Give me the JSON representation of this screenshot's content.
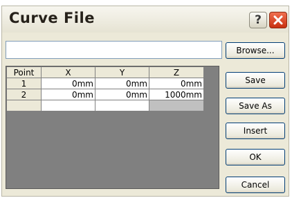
{
  "window": {
    "title": "Curve File",
    "help_glyph": "?",
    "close_glyph": "✕"
  },
  "file_path": {
    "value": ""
  },
  "buttons": {
    "browse": "Browse...",
    "save": "Save",
    "save_as": "Save As",
    "insert": "Insert",
    "ok": "OK",
    "cancel": "Cancel"
  },
  "table": {
    "columns": [
      "Point",
      "X",
      "Y",
      "Z"
    ],
    "rows": [
      {
        "point": "1",
        "x": "0mm",
        "y": "0mm",
        "z": "0mm"
      },
      {
        "point": "2",
        "x": "0mm",
        "y": "0mm",
        "z": "1000mm"
      }
    ]
  },
  "colors": {
    "dialog_bg": "#ece9d8",
    "grid_bg": "#808080",
    "close_button": "#d6441f"
  },
  "icons": {
    "help": "help-icon",
    "close": "close-icon"
  }
}
